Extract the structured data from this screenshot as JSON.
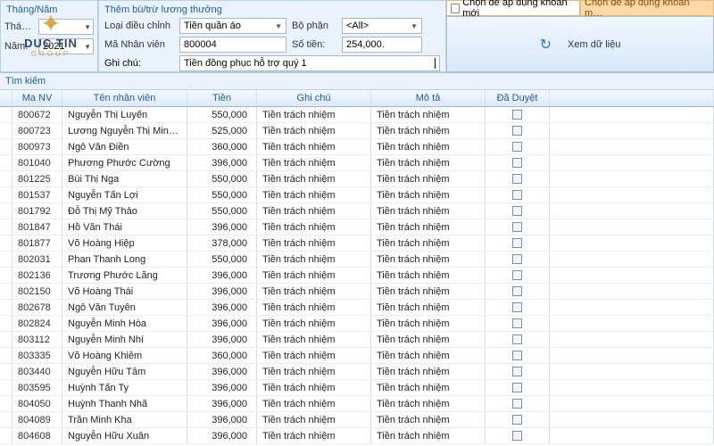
{
  "logo": {
    "brand": "DUC TIN",
    "sub": "GROUP"
  },
  "period": {
    "header": "Tháng/Năm",
    "month_label": "Thá…",
    "month_value": "",
    "year_label": "Năm:",
    "year_value": "2021"
  },
  "form": {
    "header": "Thêm bù/trừ lương thưởng",
    "type_label": "Loại điều chỉnh",
    "type_value": "Tiền quần áo",
    "dept_label": "Bộ phận",
    "dept_value": "<All>",
    "emp_label": "Mã Nhân viên",
    "emp_value": "800004",
    "amount_label": "Số tiền:",
    "amount_value": "254,000.",
    "note_label": "Ghi chú:",
    "note_value": "Tiền đồng phục hỗ trợ quý 1"
  },
  "right": {
    "check1": "Chọn để áp dụng khoản mới",
    "check2": "Chọn để áp dụng khoản m…",
    "view_btn": "Xem dữ liệu"
  },
  "search_label": "Tìm kiếm",
  "columns": {
    "ma": "Ma NV",
    "ten": "Tên nhân viên",
    "tien": "Tiền",
    "ghi": "Ghi chú",
    "mota": "Mô tả",
    "duyet": "Đã Duyệt"
  },
  "rows": [
    {
      "ma": "800672",
      "ten": "Nguyễn Thị Luyến",
      "tien": "550,000",
      "ghi": "Tiền trách nhiệm",
      "mota": "Tiền trách nhiệm"
    },
    {
      "ma": "800723",
      "ten": "Lương Nguyễn Thị Minh...",
      "tien": "525,000",
      "ghi": "Tiền trách nhiệm",
      "mota": "Tiền trách nhiệm"
    },
    {
      "ma": "800973",
      "ten": "Ngô Văn Điền",
      "tien": "360,000",
      "ghi": "Tiền trách nhiệm",
      "mota": "Tiền trách nhiệm"
    },
    {
      "ma": "801040",
      "ten": "Phương Phước Cường",
      "tien": "396,000",
      "ghi": "Tiền trách nhiệm",
      "mota": "Tiền trách nhiệm"
    },
    {
      "ma": "801225",
      "ten": "Bùi Thị Nga",
      "tien": "550,000",
      "ghi": "Tiền trách nhiệm",
      "mota": "Tiền trách nhiệm"
    },
    {
      "ma": "801537",
      "ten": "Nguyễn Tấn Lợi",
      "tien": "550,000",
      "ghi": "Tiền trách nhiệm",
      "mota": "Tiền trách nhiệm"
    },
    {
      "ma": "801792",
      "ten": "Đỗ Thị Mỹ Thảo",
      "tien": "550,000",
      "ghi": "Tiền trách nhiệm",
      "mota": "Tiền trách nhiệm"
    },
    {
      "ma": "801847",
      "ten": "Hồ Văn Thái",
      "tien": "396,000",
      "ghi": "Tiền trách nhiệm",
      "mota": "Tiền trách nhiệm"
    },
    {
      "ma": "801877",
      "ten": "Võ Hoàng Hiệp",
      "tien": "378,000",
      "ghi": "Tiền trách nhiệm",
      "mota": "Tiền trách nhiệm"
    },
    {
      "ma": "802031",
      "ten": "Phan Thanh Long",
      "tien": "550,000",
      "ghi": "Tiền trách nhiệm",
      "mota": "Tiền trách nhiệm"
    },
    {
      "ma": "802136",
      "ten": "Trương Phước Lãng",
      "tien": "396,000",
      "ghi": "Tiền trách nhiệm",
      "mota": "Tiền trách nhiệm"
    },
    {
      "ma": "802150",
      "ten": "Võ Hoàng Thái",
      "tien": "396,000",
      "ghi": "Tiền trách nhiệm",
      "mota": "Tiền trách nhiệm"
    },
    {
      "ma": "802678",
      "ten": "Ngô Văn Tuyên",
      "tien": "396,000",
      "ghi": "Tiền trách nhiệm",
      "mota": "Tiền trách nhiệm"
    },
    {
      "ma": "802824",
      "ten": "Nguyễn Minh Hòa",
      "tien": "396,000",
      "ghi": "Tiền trách nhiệm",
      "mota": "Tiền trách nhiệm"
    },
    {
      "ma": "803112",
      "ten": "Nguyễn Minh Nhí",
      "tien": "396,000",
      "ghi": "Tiền trách nhiệm",
      "mota": "Tiền trách nhiệm"
    },
    {
      "ma": "803335",
      "ten": "Võ Hoàng Khiêm",
      "tien": "360,000",
      "ghi": "Tiền trách nhiệm",
      "mota": "Tiền trách nhiệm"
    },
    {
      "ma": "803440",
      "ten": "Nguyễn Hữu Tâm",
      "tien": "396,000",
      "ghi": "Tiền trách nhiệm",
      "mota": "Tiền trách nhiệm"
    },
    {
      "ma": "803595",
      "ten": "Huỳnh Tấn Ty",
      "tien": "396,000",
      "ghi": "Tiền trách nhiệm",
      "mota": "Tiền trách nhiệm"
    },
    {
      "ma": "804050",
      "ten": "Huỳnh Thanh Nhã",
      "tien": "396,000",
      "ghi": "Tiền trách nhiệm",
      "mota": "Tiền trách nhiệm"
    },
    {
      "ma": "804089",
      "ten": "Trần Minh Kha",
      "tien": "396,000",
      "ghi": "Tiền trách nhiệm",
      "mota": "Tiền trách nhiệm"
    },
    {
      "ma": "804608",
      "ten": "Nguyễn Hữu Xuân",
      "tien": "396,000",
      "ghi": "Tiền trách nhiệm",
      "mota": "Tiền trách nhiệm"
    }
  ]
}
